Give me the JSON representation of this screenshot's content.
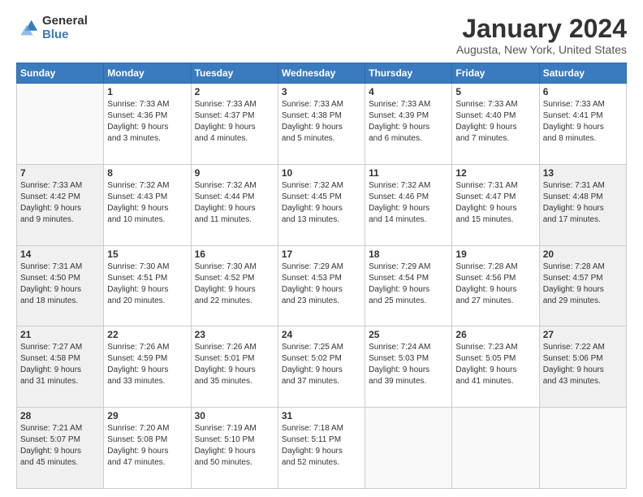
{
  "logo": {
    "general": "General",
    "blue": "Blue"
  },
  "title": {
    "main": "January 2024",
    "sub": "Augusta, New York, United States"
  },
  "calendar": {
    "headers": [
      "Sunday",
      "Monday",
      "Tuesday",
      "Wednesday",
      "Thursday",
      "Friday",
      "Saturday"
    ],
    "rows": [
      [
        {
          "day": "",
          "info": "",
          "empty": true
        },
        {
          "day": "1",
          "info": "Sunrise: 7:33 AM\nSunset: 4:36 PM\nDaylight: 9 hours\nand 3 minutes."
        },
        {
          "day": "2",
          "info": "Sunrise: 7:33 AM\nSunset: 4:37 PM\nDaylight: 9 hours\nand 4 minutes."
        },
        {
          "day": "3",
          "info": "Sunrise: 7:33 AM\nSunset: 4:38 PM\nDaylight: 9 hours\nand 5 minutes."
        },
        {
          "day": "4",
          "info": "Sunrise: 7:33 AM\nSunset: 4:39 PM\nDaylight: 9 hours\nand 6 minutes."
        },
        {
          "day": "5",
          "info": "Sunrise: 7:33 AM\nSunset: 4:40 PM\nDaylight: 9 hours\nand 7 minutes."
        },
        {
          "day": "6",
          "info": "Sunrise: 7:33 AM\nSunset: 4:41 PM\nDaylight: 9 hours\nand 8 minutes."
        }
      ],
      [
        {
          "day": "7",
          "info": "Sunrise: 7:33 AM\nSunset: 4:42 PM\nDaylight: 9 hours\nand 9 minutes.",
          "shaded": true
        },
        {
          "day": "8",
          "info": "Sunrise: 7:32 AM\nSunset: 4:43 PM\nDaylight: 9 hours\nand 10 minutes."
        },
        {
          "day": "9",
          "info": "Sunrise: 7:32 AM\nSunset: 4:44 PM\nDaylight: 9 hours\nand 11 minutes."
        },
        {
          "day": "10",
          "info": "Sunrise: 7:32 AM\nSunset: 4:45 PM\nDaylight: 9 hours\nand 13 minutes."
        },
        {
          "day": "11",
          "info": "Sunrise: 7:32 AM\nSunset: 4:46 PM\nDaylight: 9 hours\nand 14 minutes."
        },
        {
          "day": "12",
          "info": "Sunrise: 7:31 AM\nSunset: 4:47 PM\nDaylight: 9 hours\nand 15 minutes."
        },
        {
          "day": "13",
          "info": "Sunrise: 7:31 AM\nSunset: 4:48 PM\nDaylight: 9 hours\nand 17 minutes.",
          "shaded": true
        }
      ],
      [
        {
          "day": "14",
          "info": "Sunrise: 7:31 AM\nSunset: 4:50 PM\nDaylight: 9 hours\nand 18 minutes.",
          "shaded": true
        },
        {
          "day": "15",
          "info": "Sunrise: 7:30 AM\nSunset: 4:51 PM\nDaylight: 9 hours\nand 20 minutes."
        },
        {
          "day": "16",
          "info": "Sunrise: 7:30 AM\nSunset: 4:52 PM\nDaylight: 9 hours\nand 22 minutes."
        },
        {
          "day": "17",
          "info": "Sunrise: 7:29 AM\nSunset: 4:53 PM\nDaylight: 9 hours\nand 23 minutes."
        },
        {
          "day": "18",
          "info": "Sunrise: 7:29 AM\nSunset: 4:54 PM\nDaylight: 9 hours\nand 25 minutes."
        },
        {
          "day": "19",
          "info": "Sunrise: 7:28 AM\nSunset: 4:56 PM\nDaylight: 9 hours\nand 27 minutes."
        },
        {
          "day": "20",
          "info": "Sunrise: 7:28 AM\nSunset: 4:57 PM\nDaylight: 9 hours\nand 29 minutes.",
          "shaded": true
        }
      ],
      [
        {
          "day": "21",
          "info": "Sunrise: 7:27 AM\nSunset: 4:58 PM\nDaylight: 9 hours\nand 31 minutes.",
          "shaded": true
        },
        {
          "day": "22",
          "info": "Sunrise: 7:26 AM\nSunset: 4:59 PM\nDaylight: 9 hours\nand 33 minutes."
        },
        {
          "day": "23",
          "info": "Sunrise: 7:26 AM\nSunset: 5:01 PM\nDaylight: 9 hours\nand 35 minutes."
        },
        {
          "day": "24",
          "info": "Sunrise: 7:25 AM\nSunset: 5:02 PM\nDaylight: 9 hours\nand 37 minutes."
        },
        {
          "day": "25",
          "info": "Sunrise: 7:24 AM\nSunset: 5:03 PM\nDaylight: 9 hours\nand 39 minutes."
        },
        {
          "day": "26",
          "info": "Sunrise: 7:23 AM\nSunset: 5:05 PM\nDaylight: 9 hours\nand 41 minutes."
        },
        {
          "day": "27",
          "info": "Sunrise: 7:22 AM\nSunset: 5:06 PM\nDaylight: 9 hours\nand 43 minutes.",
          "shaded": true
        }
      ],
      [
        {
          "day": "28",
          "info": "Sunrise: 7:21 AM\nSunset: 5:07 PM\nDaylight: 9 hours\nand 45 minutes.",
          "shaded": true
        },
        {
          "day": "29",
          "info": "Sunrise: 7:20 AM\nSunset: 5:08 PM\nDaylight: 9 hours\nand 47 minutes."
        },
        {
          "day": "30",
          "info": "Sunrise: 7:19 AM\nSunset: 5:10 PM\nDaylight: 9 hours\nand 50 minutes."
        },
        {
          "day": "31",
          "info": "Sunrise: 7:18 AM\nSunset: 5:11 PM\nDaylight: 9 hours\nand 52 minutes."
        },
        {
          "day": "",
          "info": "",
          "empty": true
        },
        {
          "day": "",
          "info": "",
          "empty": true
        },
        {
          "day": "",
          "info": "",
          "empty": true
        }
      ]
    ]
  }
}
